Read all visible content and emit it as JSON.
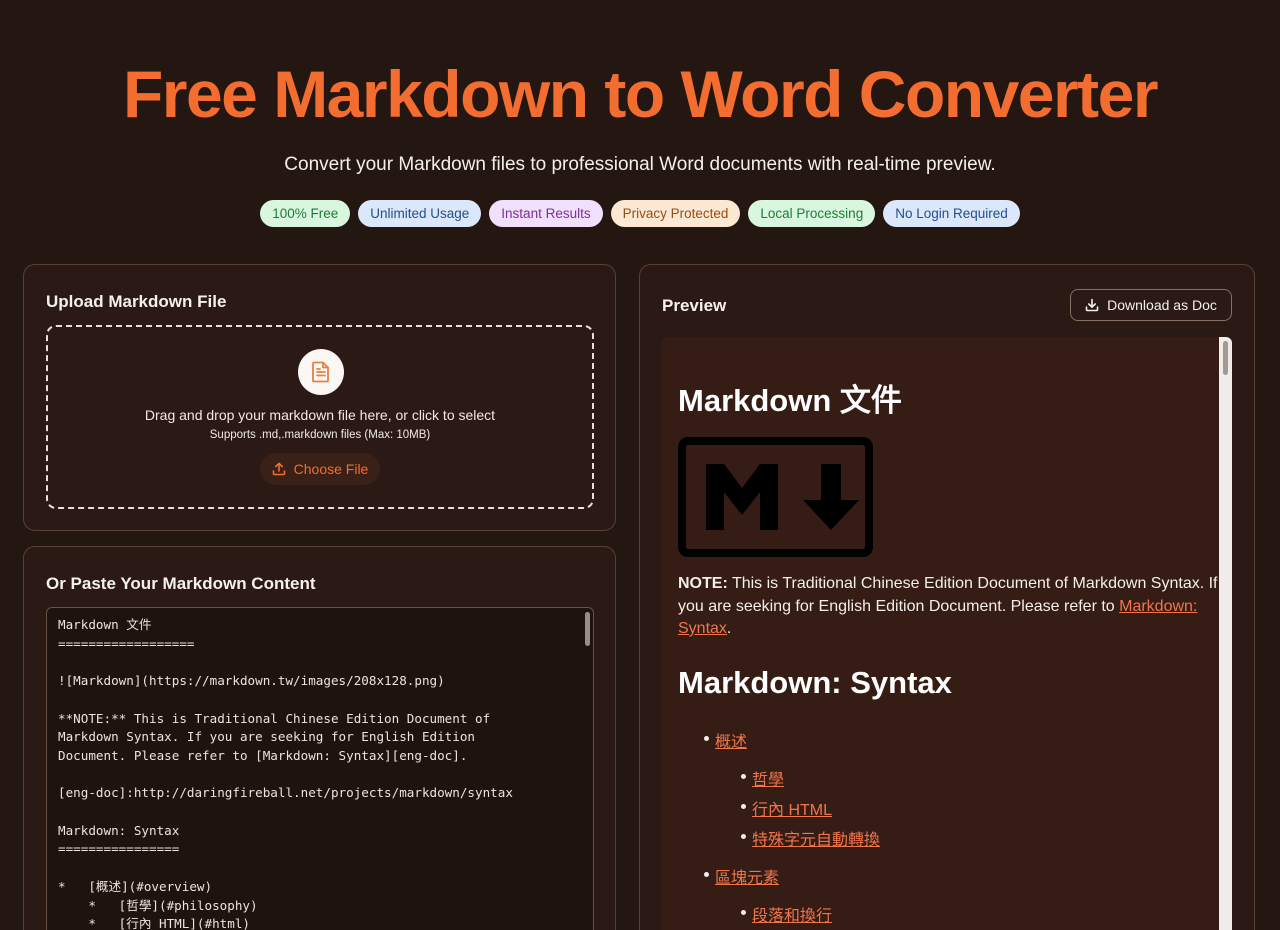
{
  "hero": {
    "title": "Free Markdown to Word Converter",
    "subtitle": "Convert your Markdown files to professional Word documents with real-time preview."
  },
  "badges": [
    {
      "label": "100% Free",
      "bg": "#d9f7df",
      "fg": "#1f7a3a"
    },
    {
      "label": "Unlimited Usage",
      "bg": "#dbe8fb",
      "fg": "#244f8f"
    },
    {
      "label": "Instant Results",
      "bg": "#f1e0fb",
      "fg": "#7b2f9c"
    },
    {
      "label": "Privacy Protected",
      "bg": "#fde9d3",
      "fg": "#9a4b12"
    },
    {
      "label": "Local Processing",
      "bg": "#d9f7df",
      "fg": "#1f7a3a"
    },
    {
      "label": "No Login Required",
      "bg": "#dbe8fb",
      "fg": "#244f8f"
    }
  ],
  "upload": {
    "title": "Upload Markdown File",
    "drop_text": "Drag and drop your markdown file here, or click to select",
    "supports_text": "Supports .md,.markdown files (Max: 10MB)",
    "choose_label": "Choose File"
  },
  "paste": {
    "title": "Or Paste Your Markdown Content",
    "content": "Markdown 文件\n==================\n\n![Markdown](https://markdown.tw/images/208x128.png)\n\n**NOTE:** This is Traditional Chinese Edition Document of\nMarkdown Syntax. If you are seeking for English Edition\nDocument. Please refer to [Markdown: Syntax][eng-doc].\n\n[eng-doc]:http://daringfireball.net/projects/markdown/syntax\n\nMarkdown: Syntax\n================\n\n*   [概述](#overview)\n    *   [哲學](#philosophy)\n    *   [行內 HTML](#html)"
  },
  "preview": {
    "title": "Preview",
    "download_label": "Download as Doc",
    "h1": "Markdown 文件",
    "logo_letters": "M",
    "note_label": "NOTE:",
    "note_text": " This is Traditional Chinese Edition Document of Markdown Syntax. If you are seeking for English Edition Document. Please refer to ",
    "note_link": "Markdown: Syntax",
    "note_end": ".",
    "h2": "Markdown: Syntax",
    "toc": {
      "item1": "概述",
      "item1_sub": [
        "哲學",
        "行內 HTML",
        "特殊字元自動轉換"
      ],
      "item2": "區塊元素",
      "item2_sub": [
        "段落和換行"
      ]
    }
  },
  "colors": {
    "accent": "#f26d2f",
    "background": "#241611"
  }
}
